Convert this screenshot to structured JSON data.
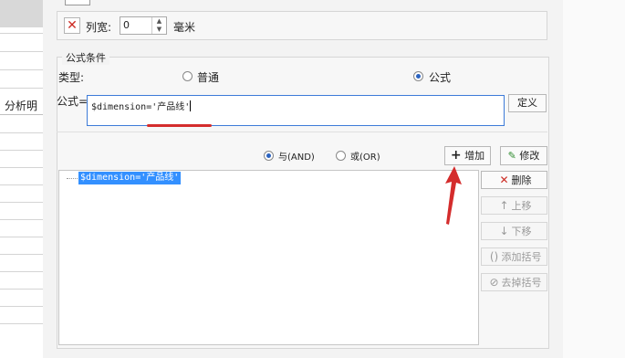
{
  "sheet": {
    "header_partial": "分析明"
  },
  "column_width": {
    "label": "列宽:",
    "value": "0",
    "unit": "毫米"
  },
  "formula_group": {
    "title": "公式条件",
    "type_label": "类型:",
    "type_options": [
      {
        "label": "普通",
        "selected": false
      },
      {
        "label": "公式",
        "selected": true
      }
    ],
    "formula_label": "公式=",
    "formula_value": "$dimension='产品线'",
    "define_button": "定义"
  },
  "logic": {
    "options": [
      {
        "label": "与(AND)",
        "selected": true
      },
      {
        "label": "或(OR)",
        "selected": false
      }
    ],
    "add_button": "增加",
    "modify_button": "修改"
  },
  "conditions": [
    "$dimension='产品线'"
  ],
  "side_buttons": [
    {
      "label": "删除",
      "icon": "delete-x-icon",
      "enabled": true
    },
    {
      "label": "上移",
      "icon": "arrow-up-icon",
      "enabled": false
    },
    {
      "label": "下移",
      "icon": "arrow-down-icon",
      "enabled": false
    },
    {
      "label": "添加括号",
      "icon": "add-bracket-icon",
      "enabled": false
    },
    {
      "label": "去掉括号",
      "icon": "remove-bracket-icon",
      "enabled": false
    }
  ],
  "colors": {
    "accent": "#2b63c0",
    "selection": "#3390ff",
    "annotation": "#d42c2c",
    "delete": "#cc2a22"
  }
}
